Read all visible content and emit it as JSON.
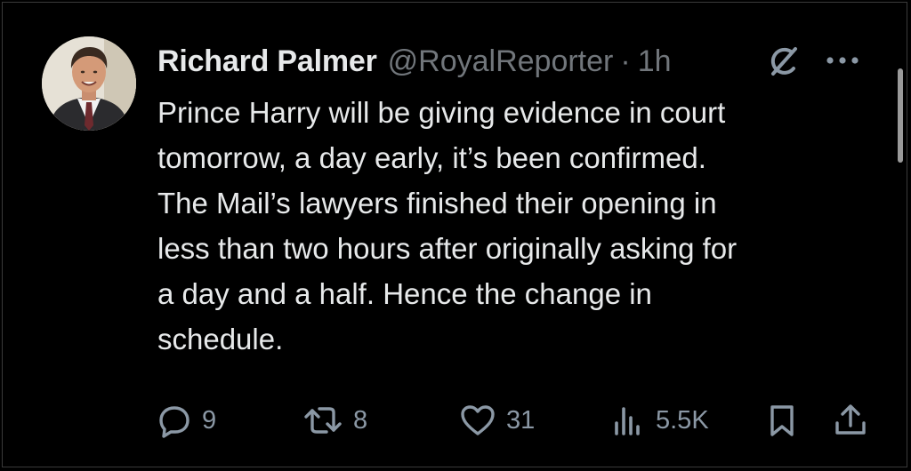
{
  "tweet": {
    "author_name": "Richard Palmer",
    "handle": "@RoyalReporter",
    "separator": "·",
    "time": "1h",
    "text": "Prince Harry will be giving evidence in court\ntomorrow, a day early, it’s been confirmed.\nThe Mail’s lawyers finished their opening in\nless than two hours after originally asking for\na day and a half. Hence the change in\nschedule.",
    "avatar_icon": "profile-photo",
    "header_icons": [
      "grok-icon",
      "more-icon"
    ]
  },
  "actions": {
    "replies": "9",
    "reposts": "8",
    "likes": "31",
    "views": "5.5K",
    "icons": [
      "reply-icon",
      "repost-icon",
      "like-icon",
      "views-icon",
      "bookmark-icon",
      "share-icon"
    ]
  },
  "colors": {
    "background": "#000000",
    "text_primary": "#e7e9ea",
    "text_secondary": "#71767b",
    "action_gray": "#8b98a5"
  }
}
